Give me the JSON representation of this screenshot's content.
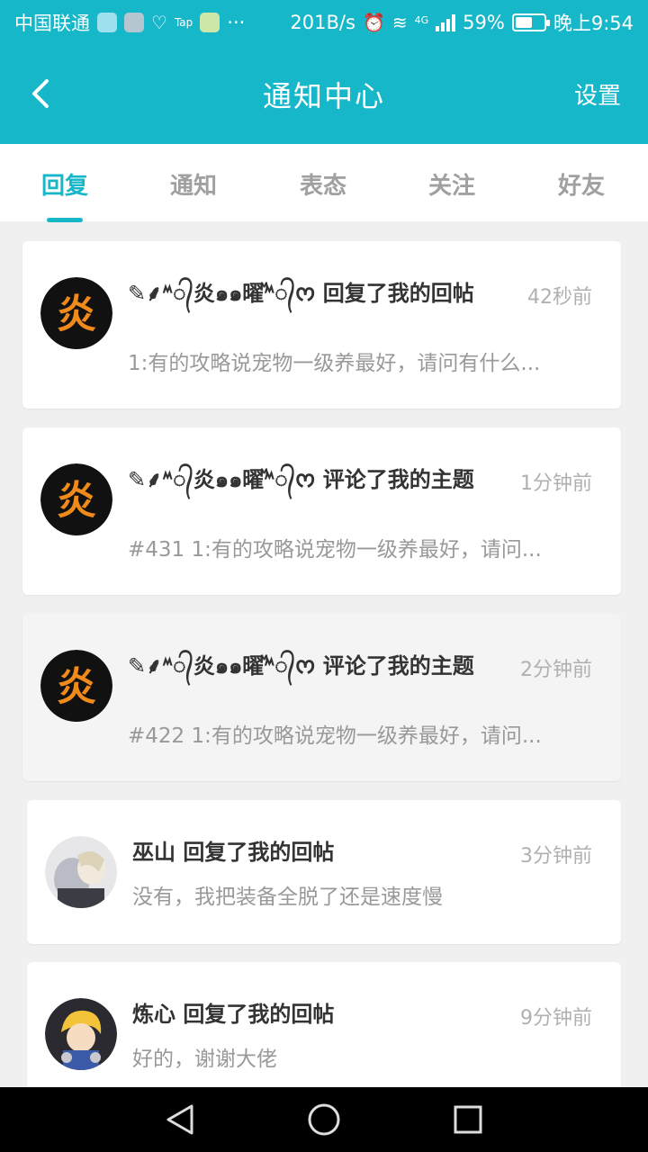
{
  "status_bar": {
    "carrier": "中国联通",
    "ellipsis": "···",
    "speed": "201B/s",
    "network": "4G",
    "battery": "59%",
    "battery_level": 0.59,
    "time": "晚上9:54"
  },
  "header": {
    "title": "通知中心",
    "settings_label": "设置"
  },
  "tabs": [
    {
      "label": "回复",
      "active": true
    },
    {
      "label": "通知",
      "active": false
    },
    {
      "label": "表态",
      "active": false
    },
    {
      "label": "关注",
      "active": false
    },
    {
      "label": "好友",
      "active": false
    }
  ],
  "notifications": [
    {
      "user": "✎⸙ᔿ᭄炎๑๑曜ⷨᔿ᭄ᰔ",
      "action": "回复了我的回帖",
      "time": "42秒前",
      "preview": "1:有的攻略说宠物一级养最好，请问有什么..."
    },
    {
      "user": "✎⸙ᔿ᭄炎๑๑曜ⷨᔿ᭄ᰔ",
      "action": "评论了我的主题",
      "time": "1分钟前",
      "preview": "#431 1:有的攻略说宠物一级养最好，请问..."
    },
    {
      "user": "✎⸙ᔿ᭄炎๑๑曜ⷨᔿ᭄ᰔ",
      "action": "评论了我的主题",
      "time": "2分钟前",
      "preview": "#422 1:有的攻略说宠物一级养最好，请问..."
    },
    {
      "user": "巫山",
      "action": "回复了我的回帖",
      "time": "3分钟前",
      "preview": "没有，我把装备全脱了还是速度慢"
    },
    {
      "user": "炼心",
      "action": "回复了我的回帖",
      "time": "9分钟前",
      "preview": "好的，谢谢大佬"
    }
  ],
  "colors": {
    "accent": "#16b7c9",
    "tab_inactive": "#a0a0a0",
    "time_text": "#b0b0b0",
    "preview_text": "#999999"
  }
}
